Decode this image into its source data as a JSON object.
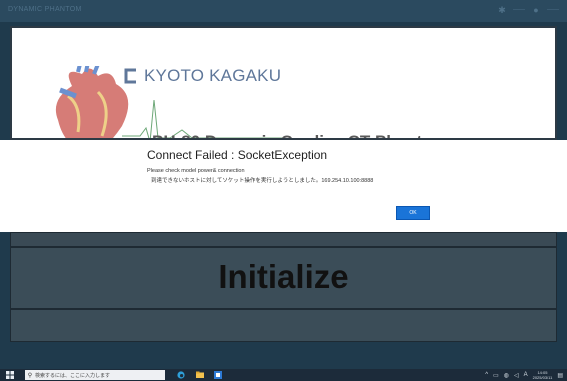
{
  "titlebar": {
    "app_title": "DYNAMIC PHANTOM",
    "right_items": [
      "gear-icon",
      "user-icon"
    ]
  },
  "header_panel": {
    "company_name": "KYOTO KAGAKU",
    "product_title": "PH-80 Dynamic Cardiac CT Phant"
  },
  "dialog": {
    "title": "Connect Failed : SocketException",
    "line1": "Please check model power& connection",
    "line2": "到達できないホストに対してソケット操作を実行しようとしました。169.254.10.100:8888",
    "ok_label": "OK"
  },
  "init_panel": {
    "label": "Initialize"
  },
  "taskbar": {
    "search_placeholder": "検索するには、ここに入力します",
    "ime_label": "A",
    "time": "14:05",
    "date": "2025/03/11"
  },
  "colors": {
    "accent": "#1a74d8",
    "titlebar": "#2b4a5f",
    "panel": "#3b4d58"
  }
}
